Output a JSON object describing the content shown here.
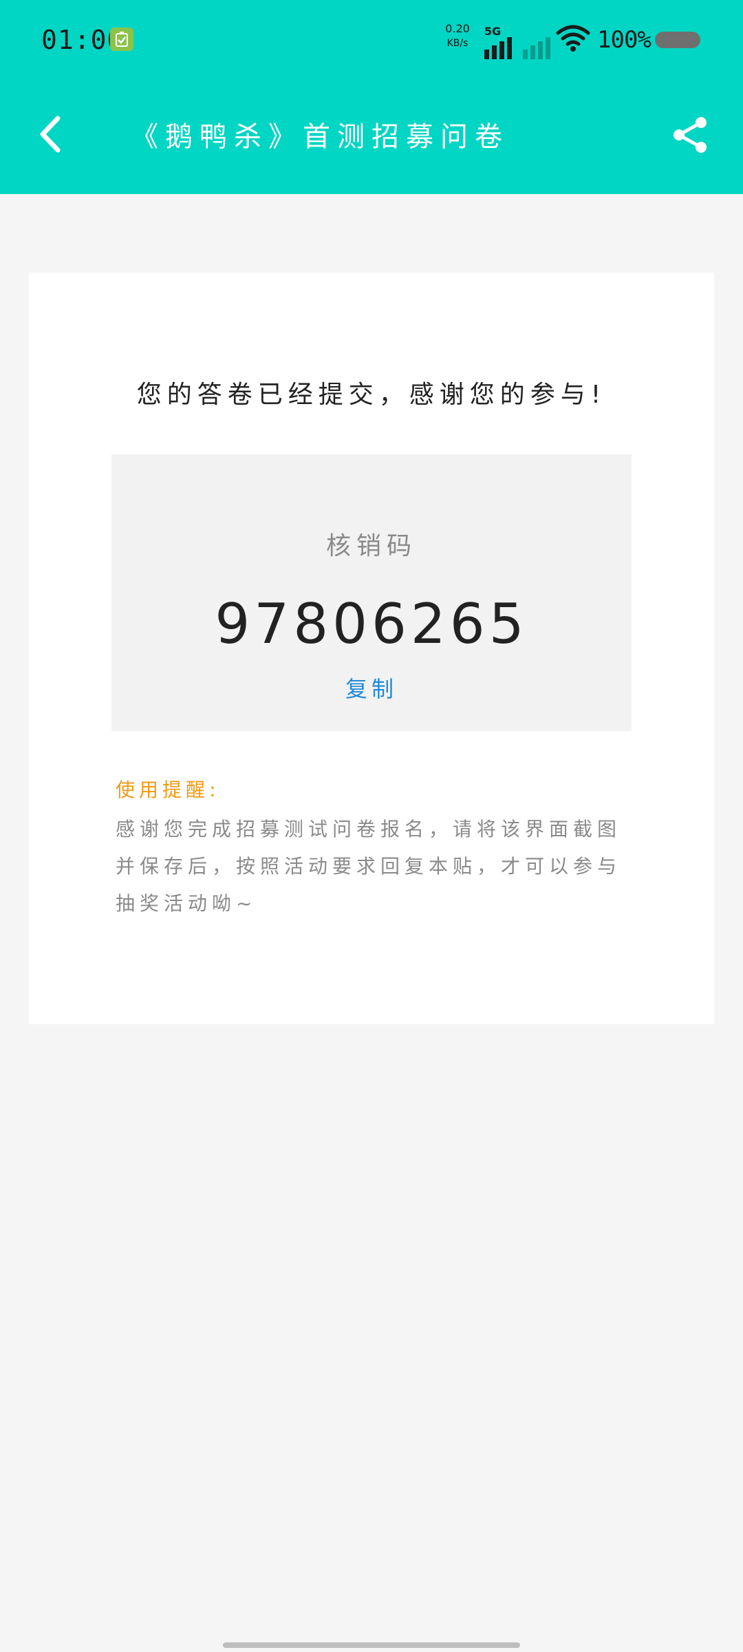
{
  "status_bar": {
    "time": "01:00",
    "net_speed_value": "0.20",
    "net_speed_unit": "KB/s",
    "network_type": "5G",
    "battery_percent": "100%"
  },
  "app_bar": {
    "title": "《鹅鸭杀》首测招募问卷"
  },
  "card": {
    "thanks_message": "您的答卷已经提交，感谢您的参与!",
    "code_label": "核销码",
    "code_value": "97806265",
    "copy_label": "复制",
    "tip_title": "使用提醒:",
    "tip_body": "感谢您完成招募测试问卷报名，请将该界面截图并保存后，按照活动要求回复本贴，才可以参与抽奖活动呦~"
  },
  "colors": {
    "header": "#00d6c3",
    "copy_link": "#1f8ad6",
    "tip_title": "#f29a12"
  },
  "icons": {
    "back": "chevron-left-icon",
    "share": "share-icon",
    "wifi": "wifi-icon",
    "signal": "signal-icon",
    "battery_saver": "battery-saver-icon"
  }
}
